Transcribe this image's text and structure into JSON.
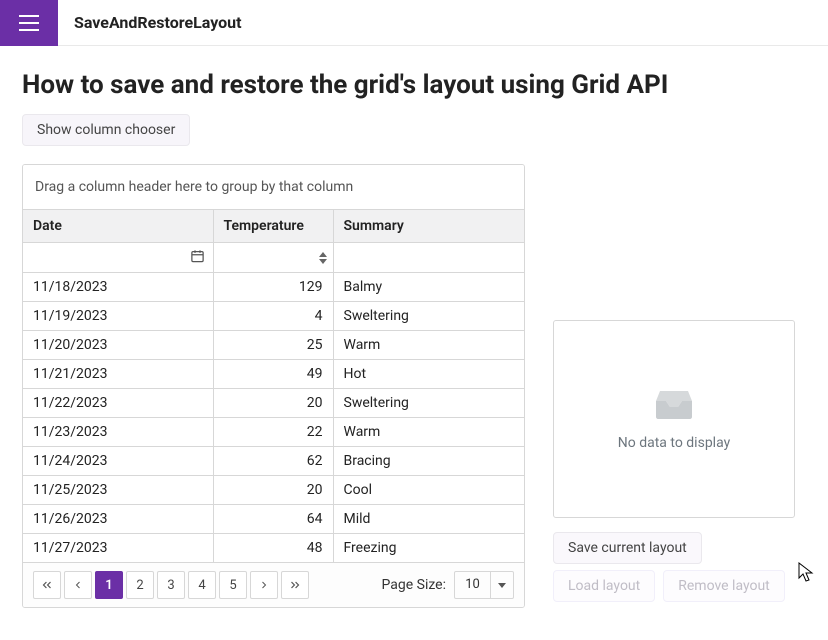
{
  "header": {
    "app_title": "SaveAndRestoreLayout"
  },
  "page": {
    "title": "How to save and restore the grid's layout using Grid API",
    "column_chooser_label": "Show column chooser"
  },
  "grid": {
    "group_hint": "Drag a column header here to group by that column",
    "columns": {
      "date": "Date",
      "temperature": "Temperature",
      "summary": "Summary"
    },
    "rows": [
      {
        "date": "11/18/2023",
        "temperature": 129,
        "summary": "Balmy"
      },
      {
        "date": "11/19/2023",
        "temperature": 4,
        "summary": "Sweltering"
      },
      {
        "date": "11/20/2023",
        "temperature": 25,
        "summary": "Warm"
      },
      {
        "date": "11/21/2023",
        "temperature": 49,
        "summary": "Hot"
      },
      {
        "date": "11/22/2023",
        "temperature": 20,
        "summary": "Sweltering"
      },
      {
        "date": "11/23/2023",
        "temperature": 22,
        "summary": "Warm"
      },
      {
        "date": "11/24/2023",
        "temperature": 62,
        "summary": "Bracing"
      },
      {
        "date": "11/25/2023",
        "temperature": 20,
        "summary": "Cool"
      },
      {
        "date": "11/26/2023",
        "temperature": 64,
        "summary": "Mild"
      },
      {
        "date": "11/27/2023",
        "temperature": 48,
        "summary": "Freezing"
      }
    ],
    "pager": {
      "pages": [
        "1",
        "2",
        "3",
        "4",
        "5"
      ],
      "active_page": "1",
      "page_size_label": "Page Size:",
      "page_size_value": "10"
    }
  },
  "layout_panel": {
    "no_data_text": "No data to display",
    "save_label": "Save current layout",
    "load_label": "Load layout",
    "remove_label": "Remove layout"
  },
  "colors": {
    "accent": "#6b2fa6"
  }
}
